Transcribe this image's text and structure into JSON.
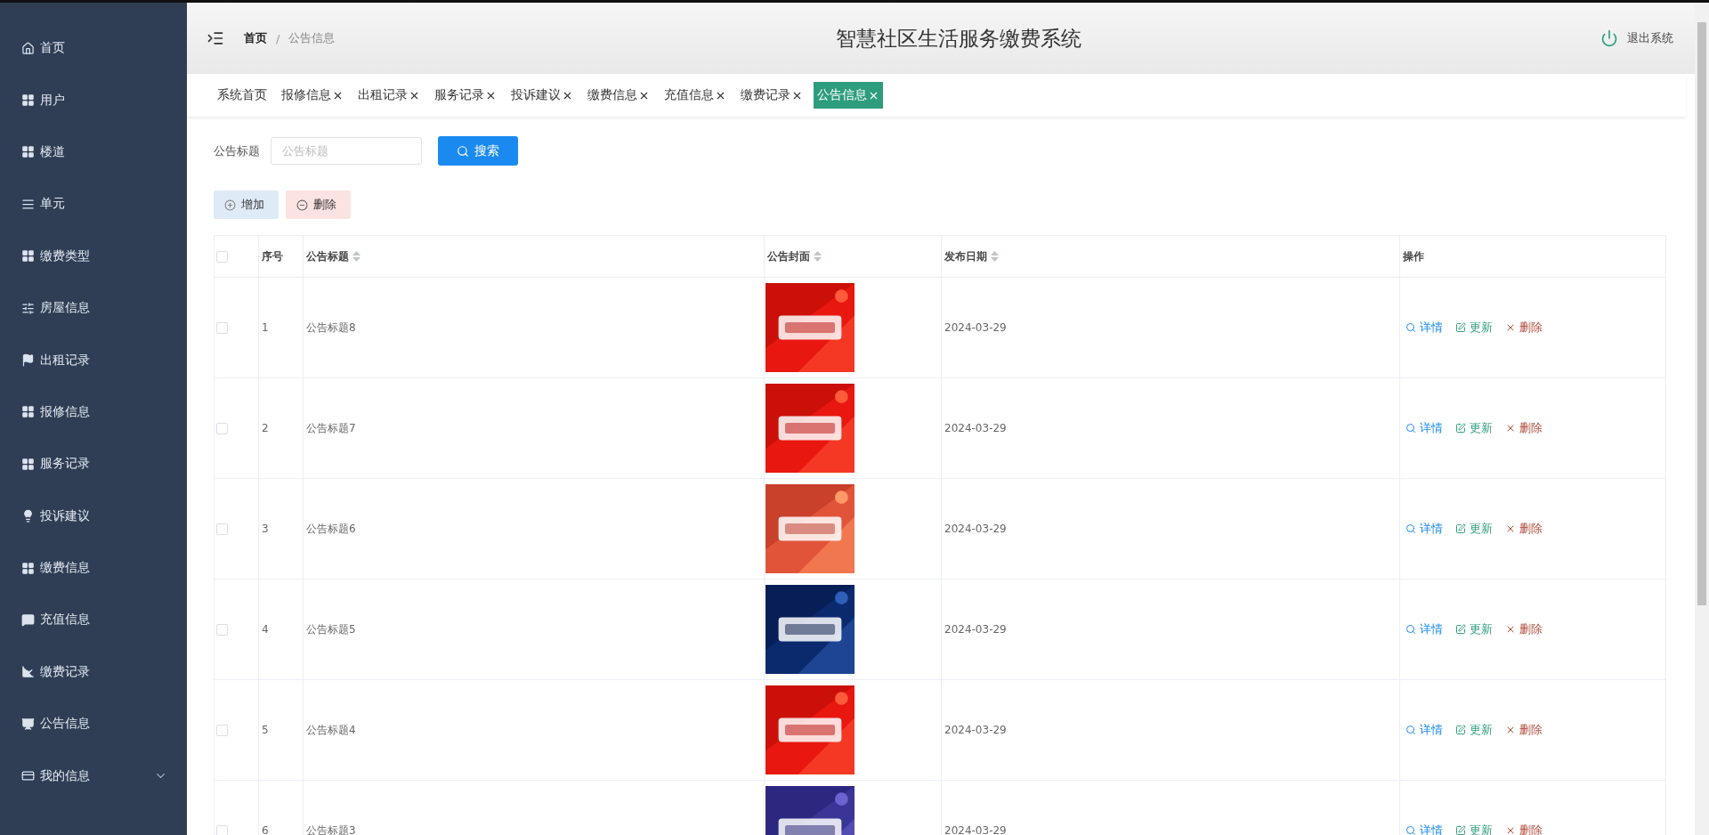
{
  "sidebar": {
    "items": [
      {
        "label": "首页",
        "kind": "home",
        "expandable": false
      },
      {
        "label": "用户",
        "kind": "grid",
        "expandable": false
      },
      {
        "label": "楼道",
        "kind": "grid",
        "expandable": false
      },
      {
        "label": "单元",
        "kind": "list",
        "expandable": false
      },
      {
        "label": "缴费类型",
        "kind": "grid",
        "expandable": false
      },
      {
        "label": "房屋信息",
        "kind": "sliders",
        "expandable": false
      },
      {
        "label": "出租记录",
        "kind": "flag",
        "expandable": false
      },
      {
        "label": "报修信息",
        "kind": "grid",
        "expandable": false
      },
      {
        "label": "服务记录",
        "kind": "grid",
        "expandable": false
      },
      {
        "label": "投诉建议",
        "kind": "bulb",
        "expandable": false
      },
      {
        "label": "缴费信息",
        "kind": "grid",
        "expandable": false
      },
      {
        "label": "充值信息",
        "kind": "chat",
        "expandable": false
      },
      {
        "label": "缴费记录",
        "kind": "chart",
        "expandable": false
      },
      {
        "label": "公告信息",
        "kind": "board",
        "expandable": false
      },
      {
        "label": "我的信息",
        "kind": "card",
        "expandable": true
      }
    ]
  },
  "header": {
    "breadcrumb": [
      "首页",
      "公告信息"
    ],
    "separator": "/",
    "title": "智慧社区生活服务缴费系统",
    "logout": "退出系统"
  },
  "tabs": [
    {
      "label": "系统首页",
      "closable": false,
      "selected": false
    },
    {
      "label": "报修信息",
      "closable": true,
      "selected": false
    },
    {
      "label": "出租记录",
      "closable": true,
      "selected": false
    },
    {
      "label": "服务记录",
      "closable": true,
      "selected": false
    },
    {
      "label": "投诉建议",
      "closable": true,
      "selected": false
    },
    {
      "label": "缴费信息",
      "closable": true,
      "selected": false
    },
    {
      "label": "充值信息",
      "closable": true,
      "selected": false
    },
    {
      "label": "缴费记录",
      "closable": true,
      "selected": false
    },
    {
      "label": "公告信息",
      "closable": true,
      "selected": true
    }
  ],
  "search": {
    "label": "公告标题",
    "placeholder": "公告标题",
    "button": "搜索"
  },
  "actions": {
    "add": "增加",
    "delete": "删除"
  },
  "table": {
    "select_all_checked": false,
    "columns": [
      {
        "label": "序号",
        "sortable": false
      },
      {
        "label": "公告标题",
        "sortable": true
      },
      {
        "label": "公告封面",
        "sortable": true
      },
      {
        "label": "发布日期",
        "sortable": true
      },
      {
        "label": "操作",
        "sortable": false
      }
    ],
    "rows": [
      {
        "index": "1",
        "title": "公告标题8",
        "date": "2024-03-29",
        "checked": false,
        "ops": [
          "详情",
          "更新",
          "删除"
        ]
      },
      {
        "index": "2",
        "title": "公告标题7",
        "date": "2024-03-29",
        "checked": false,
        "ops": [
          "详情",
          "更新",
          "删除"
        ]
      },
      {
        "index": "3",
        "title": "公告标题6",
        "date": "2024-03-29",
        "checked": false,
        "ops": [
          "详情",
          "更新",
          "删除"
        ]
      },
      {
        "index": "4",
        "title": "公告标题5",
        "date": "2024-03-29",
        "checked": false,
        "ops": [
          "详情",
          "更新",
          "删除"
        ]
      },
      {
        "index": "5",
        "title": "公告标题4",
        "date": "2024-03-29",
        "checked": false,
        "ops": [
          "详情",
          "更新",
          "删除"
        ]
      },
      {
        "index": "6",
        "title": "公告标题3",
        "date": "2024-03-29",
        "checked": false,
        "ops": [
          "详情",
          "更新",
          "删除"
        ]
      }
    ]
  }
}
